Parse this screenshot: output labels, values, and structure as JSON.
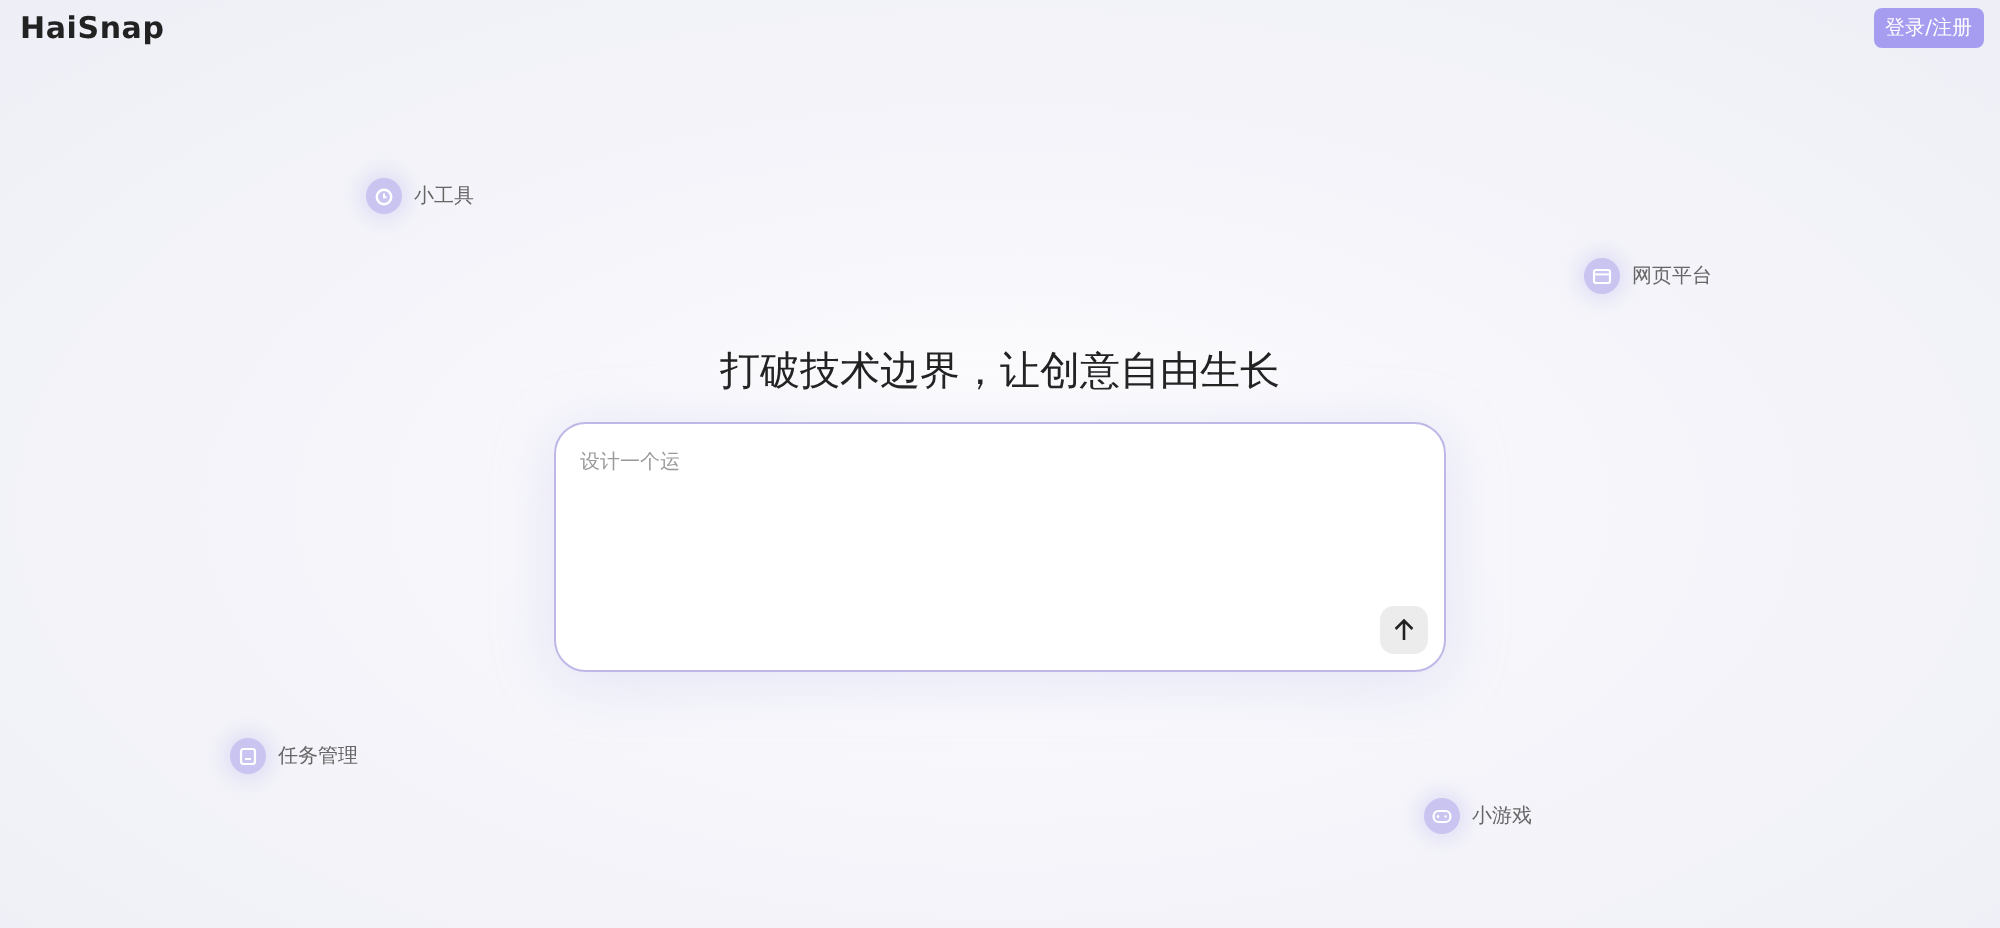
{
  "header": {
    "logo": "HaiSnap",
    "login_button": "登录/注册"
  },
  "features": [
    {
      "kind": "clock",
      "label": "小工具"
    },
    {
      "kind": "browser",
      "label": "网页平台"
    },
    {
      "kind": "task",
      "label": "任务管理"
    },
    {
      "kind": "gamepad",
      "label": "小游戏"
    }
  ],
  "headline": "打破技术边界，让创意自由生长",
  "prompt": {
    "placeholder": "设计一个运"
  }
}
